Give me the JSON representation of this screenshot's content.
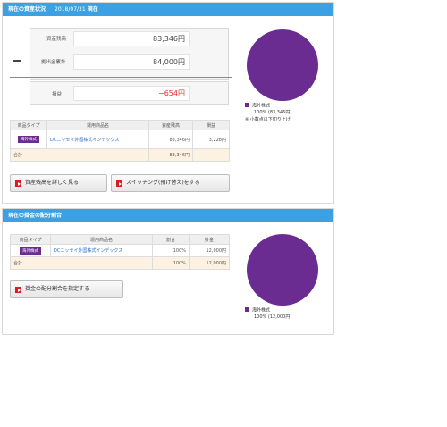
{
  "status": {
    "title": "現在の資産状況",
    "date": "2018/07/31",
    "as_of": "現在",
    "rows": [
      {
        "label": "資産残高",
        "value": "83,346円"
      },
      {
        "label": "拠出金累計",
        "value": "84,000円"
      },
      {
        "label": "損益",
        "value": "−654円"
      }
    ],
    "table": {
      "headers": [
        "商品タイプ",
        "運用商品名",
        "資産残高",
        "損益"
      ],
      "row": {
        "type": "海外株式",
        "name": "DCニッセイ外国株式インデックス",
        "balance": "83,346円",
        "pl": "3,228円"
      },
      "total_label": "合計",
      "total_balance": "83,346円"
    },
    "buttons": {
      "detail": "資産残高を詳しく見る",
      "switch": "スイッチング(預け替え)をする"
    },
    "legend": {
      "name": "海外株式",
      "detail": "100% (83,346円)",
      "note": "※ 小数点以下切り上げ"
    }
  },
  "allocation": {
    "title": "現在の掛金の配分割合",
    "table": {
      "headers": [
        "商品タイプ",
        "運用商品名",
        "割合",
        "掛金"
      ],
      "row": {
        "type": "海外株式",
        "name": "DCニッセイ外国株式インデックス",
        "ratio": "100%",
        "amount": "12,000円"
      },
      "total_label": "合計",
      "total_ratio": "100%",
      "total_amount": "12,000円"
    },
    "button": "掛金の配分割合を指定する",
    "legend": {
      "name": "海外株式",
      "detail": "100% (12,000円)"
    }
  },
  "colors": {
    "header": "#3ba1e3",
    "pie": "#6a2c91",
    "negative": "#e03030",
    "link": "#2a6cc3"
  },
  "pie_share": 1.0
}
